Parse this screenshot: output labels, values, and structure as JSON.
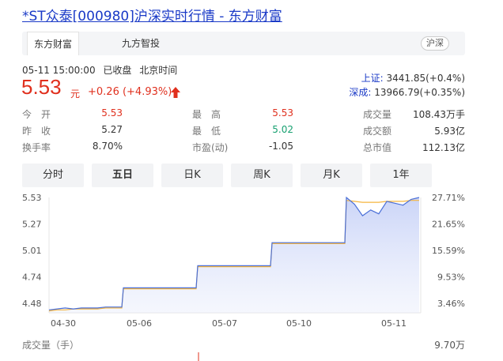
{
  "header": {
    "title": "*ST众泰[000980]沪深实时行情 - 东方财富"
  },
  "tabs": {
    "items": [
      "东方财富",
      "九方智投"
    ],
    "market_badge": "沪深"
  },
  "quote": {
    "datetime": "05-11 15:00:00",
    "status": "已收盘",
    "timezone": "北京时间",
    "price": "5.53",
    "unit": "元",
    "change": "+0.26 (+4.93%)"
  },
  "indices": {
    "sh_name": "上证:",
    "sh_value": "3441.85(+0.4%)",
    "sz_name": "深成:",
    "sz_value": "13966.79(+0.35%)"
  },
  "stats": {
    "open_label": "今　开",
    "open": "5.53",
    "high_label": "最　高",
    "high": "5.53",
    "volume_label": "成交量",
    "volume": "108.43万手",
    "prev_label": "昨　收",
    "prev": "5.27",
    "low_label": "最　低",
    "low": "5.02",
    "amount_label": "成交额",
    "amount": "5.93亿",
    "turnover_label": "换手率",
    "turnover": "8.70%",
    "pe_label": "市盈(动)",
    "pe": "-1.05",
    "mcap_label": "总市值",
    "mcap": "112.13亿"
  },
  "periods": [
    "分时",
    "五日",
    "日K",
    "周K",
    "月K",
    "1年"
  ],
  "active_period": "五日",
  "colors": {
    "up": "#e0301e",
    "down": "#16a070",
    "price_line": "#4a6fd8",
    "avg_line": "#f5b53f",
    "link": "#1a3ac7"
  },
  "chart_data": {
    "type": "line",
    "x_labels": [
      "04-30",
      "05-06",
      "05-07",
      "05-10",
      "05-11"
    ],
    "y_left_ticks": [
      "5.53",
      "5.27",
      "5.01",
      "4.74",
      "4.48"
    ],
    "y_right_ticks": [
      "27.71%",
      "21.65%",
      "15.59%",
      "9.53%",
      "3.46%"
    ],
    "ylim": [
      4.33,
      5.53
    ],
    "series": [
      {
        "values_by_day": [
          [
            4.36,
            4.37,
            4.38,
            4.37,
            4.38,
            4.38,
            4.38,
            4.39,
            4.39,
            4.39
          ],
          [
            4.59,
            4.59,
            4.59,
            4.59,
            4.59,
            4.59,
            4.59,
            4.59,
            4.59,
            4.59
          ],
          [
            4.82,
            4.82,
            4.82,
            4.82,
            4.82,
            4.82,
            4.82,
            4.82,
            4.82,
            4.82
          ],
          [
            5.06,
            5.06,
            5.06,
            5.06,
            5.06,
            5.06,
            5.06,
            5.06,
            5.06,
            5.06
          ],
          [
            5.53,
            5.46,
            5.34,
            5.4,
            5.36,
            5.49,
            5.47,
            5.45,
            5.51,
            5.53
          ]
        ]
      },
      {
        "values_by_day": [
          [
            4.35,
            4.36,
            4.36,
            4.37,
            4.37,
            4.37,
            4.37,
            4.38,
            4.38,
            4.38
          ],
          [
            4.58,
            4.58,
            4.58,
            4.58,
            4.58,
            4.58,
            4.58,
            4.58,
            4.58,
            4.58
          ],
          [
            4.81,
            4.81,
            4.81,
            4.81,
            4.81,
            4.81,
            4.81,
            4.81,
            4.81,
            4.81
          ],
          [
            5.05,
            5.05,
            5.05,
            5.05,
            5.05,
            5.05,
            5.05,
            5.05,
            5.05,
            5.05
          ],
          [
            5.5,
            5.49,
            5.48,
            5.48,
            5.48,
            5.49,
            5.49,
            5.49,
            5.5,
            5.5
          ]
        ]
      }
    ],
    "volume_label": "成交量（手）",
    "volume_max": "9.70万"
  }
}
